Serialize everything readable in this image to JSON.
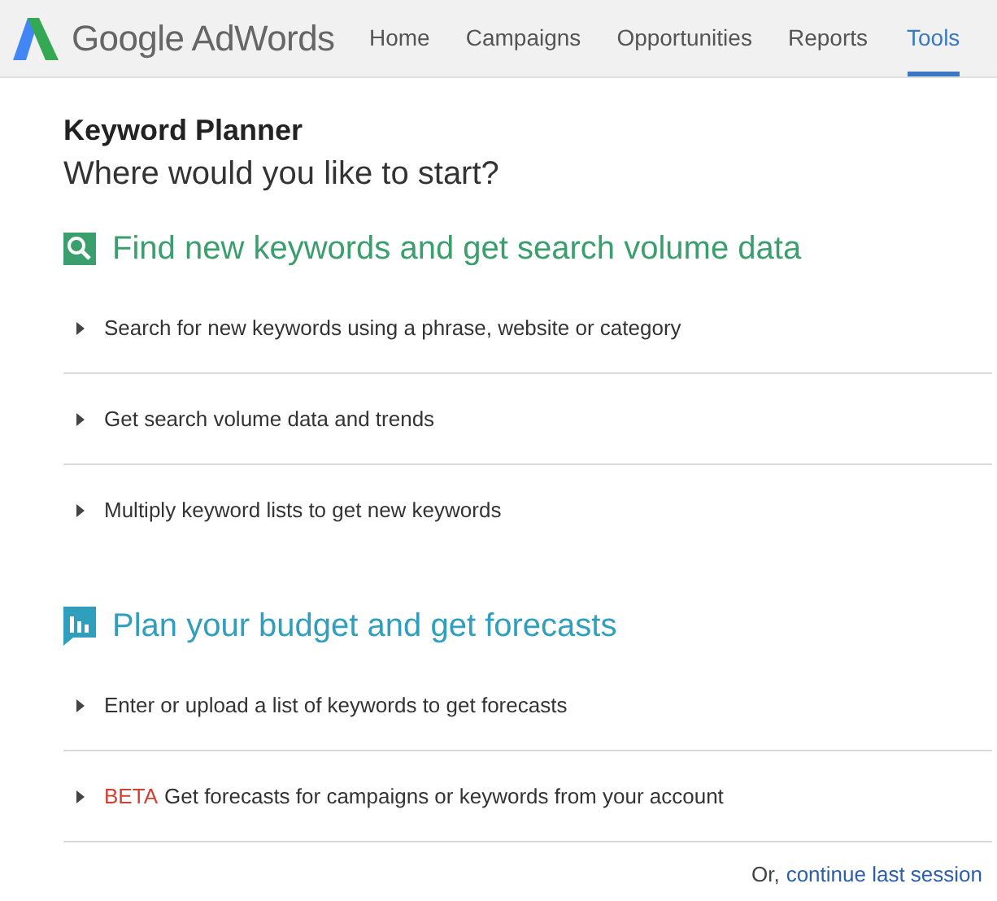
{
  "header": {
    "logo_text": "Google AdWords",
    "nav": [
      {
        "label": "Home",
        "selected": false
      },
      {
        "label": "Campaigns",
        "selected": false
      },
      {
        "label": "Opportunities",
        "selected": false
      },
      {
        "label": "Reports",
        "selected": false
      },
      {
        "label": "Tools",
        "selected": true
      }
    ]
  },
  "title": "Keyword Planner",
  "subtitle": "Where would you like to start?",
  "sections": [
    {
      "kind": "search",
      "heading": "Find new keywords and get search volume data",
      "options": [
        {
          "text": "Search for new keywords using a phrase, website or category"
        },
        {
          "text": "Get search volume data and trends"
        },
        {
          "text": "Multiply keyword lists to get new keywords"
        }
      ]
    },
    {
      "kind": "plan",
      "heading": "Plan your budget and get forecasts",
      "options": [
        {
          "text": "Enter or upload a list of keywords to get forecasts"
        },
        {
          "badge": "BETA",
          "text": "Get forecasts for campaigns or keywords from your account"
        }
      ]
    }
  ],
  "footer": {
    "prefix": "Or,",
    "link": "continue last session"
  }
}
